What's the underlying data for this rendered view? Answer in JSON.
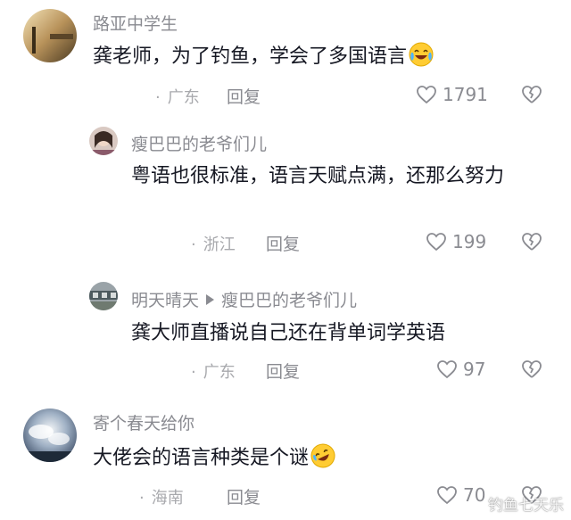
{
  "comments": [
    {
      "username": "路亚中学生",
      "text": "龚老师，为了钓鱼，学会了多国语言",
      "location": "广东",
      "reply_label": "回复",
      "likes": "1791",
      "emoji": "laughing-crying-emoji"
    },
    {
      "username": "瘦巴巴的老爷们儿",
      "text": "粤语也很标准，语言天赋点满，还那么努力",
      "location": "浙江",
      "reply_label": "回复",
      "likes": "199"
    },
    {
      "username": "明天晴天",
      "reply_to": "瘦巴巴的老爷们儿",
      "text": "龚大师直播说自己还在背单词学英语",
      "location": "广东",
      "reply_label": "回复",
      "likes": "97"
    },
    {
      "username": "寄个春天给你",
      "text": "大佬会的语言种类是个谜",
      "location": "海南",
      "reply_label": "回复",
      "likes": "70",
      "emoji": "rolling-laughing-emoji"
    }
  ],
  "watermark": "钓鱼七天乐",
  "icons": {
    "like": "heart-outline-icon",
    "dislike": "broken-heart-icon"
  },
  "colors": {
    "text": "#161823",
    "muted": "#8a8b91",
    "meta": "#a8a9ad"
  }
}
